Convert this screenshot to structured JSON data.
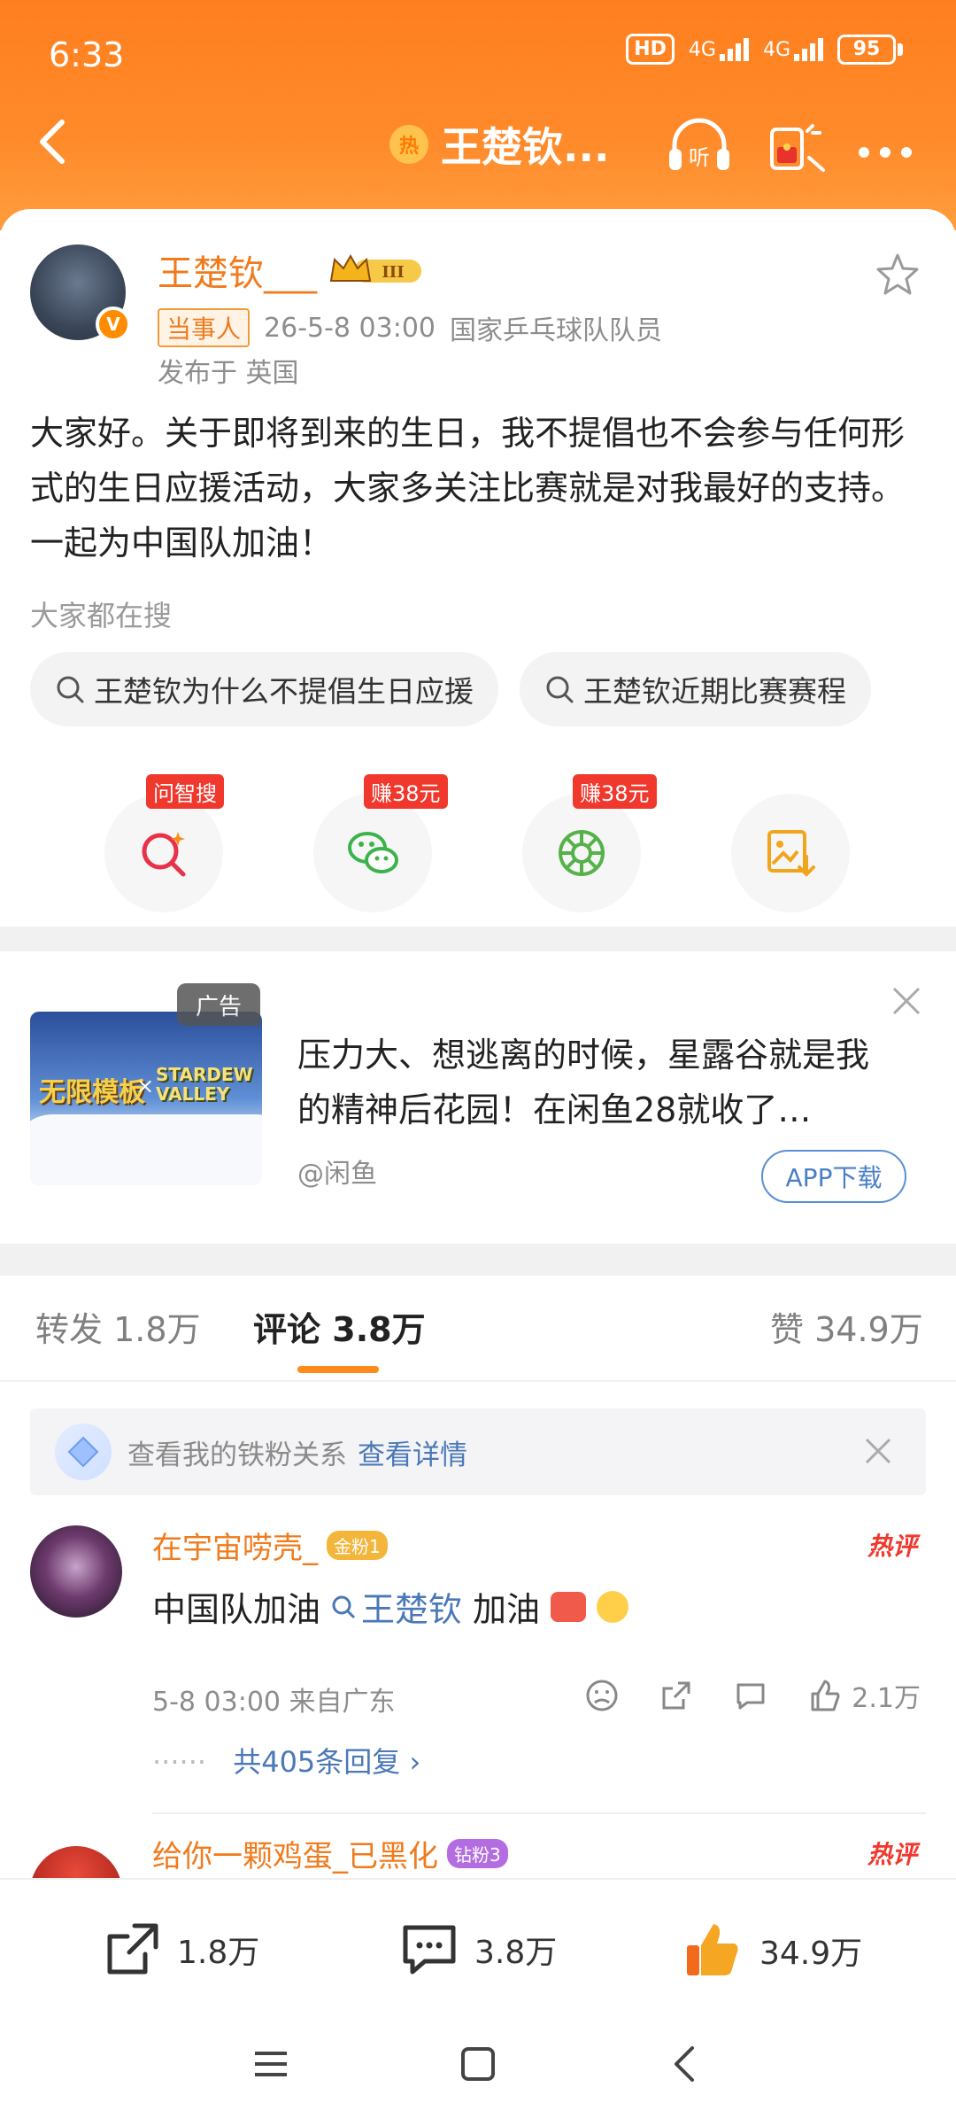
{
  "status_bar": {
    "time": "6:33",
    "hd": "HD",
    "network_1": "4G",
    "network_2": "4G",
    "battery": "95"
  },
  "nav": {
    "hot_badge": "热",
    "title": "王楚钦..."
  },
  "post": {
    "username": "王楚钦___",
    "level_badge": "III",
    "role_tag": "当事人",
    "timestamp": "26-5-8 03:00",
    "description": "国家乒乓球队队员",
    "published_at": "发布于 英国",
    "content": "大家好。关于即将到来的生日，我不提倡也不会参与任何形式的生日应援活动，大家多关注比赛就是对我最好的支持。一起为中国队加油！",
    "search_hint": "大家都在搜",
    "search_chips": [
      "王楚钦为什么不提倡生日应援",
      "王楚钦近期比赛赛程"
    ],
    "actions": [
      {
        "icon": "zhisou-icon",
        "badge": "问智搜"
      },
      {
        "icon": "wechat-icon",
        "badge": "赚38元"
      },
      {
        "icon": "moments-icon",
        "badge": "赚38元"
      },
      {
        "icon": "save-image-icon",
        "badge": ""
      }
    ]
  },
  "ad": {
    "label": "广告",
    "image_text_1": "无限模板",
    "image_text_x": "×",
    "image_text_2": "STARDEW VALLEY",
    "text": "压力大、想逃离的时候，星露谷就是我的精神后花园！在闲鱼28就收了…",
    "source": "@闲鱼",
    "download": "APP下载"
  },
  "tabs": {
    "repost_label": "转发",
    "repost_count": "1.8万",
    "comment_label": "评论",
    "comment_count": "3.8万",
    "like_label": "赞",
    "like_count": "34.9万"
  },
  "fan_banner": {
    "text": "查看我的铁粉关系",
    "link": "查看详情"
  },
  "comments": [
    {
      "username": "在宇宙唠壳_",
      "fan_badge": "金粉1",
      "hot_label": "热评",
      "text_before": "中国队加油",
      "keyword": "王楚钦",
      "text_after": "加油",
      "timestamp": "5-8 03:00",
      "location": "来自广东",
      "likes": "2.1万",
      "replies": "共405条回复"
    },
    {
      "username": "给你一颗鸡蛋_已黑化",
      "fan_badge": "钻粉3",
      "hot_label": "热评"
    }
  ],
  "bottom_bar": {
    "repost": "1.8万",
    "comment": "3.8万",
    "like": "34.9万"
  },
  "colors": {
    "brand_orange": "#ff8b1a",
    "username_orange": "#f07b1d",
    "link_blue": "#4a78b8",
    "hot_red": "#f0382d"
  }
}
